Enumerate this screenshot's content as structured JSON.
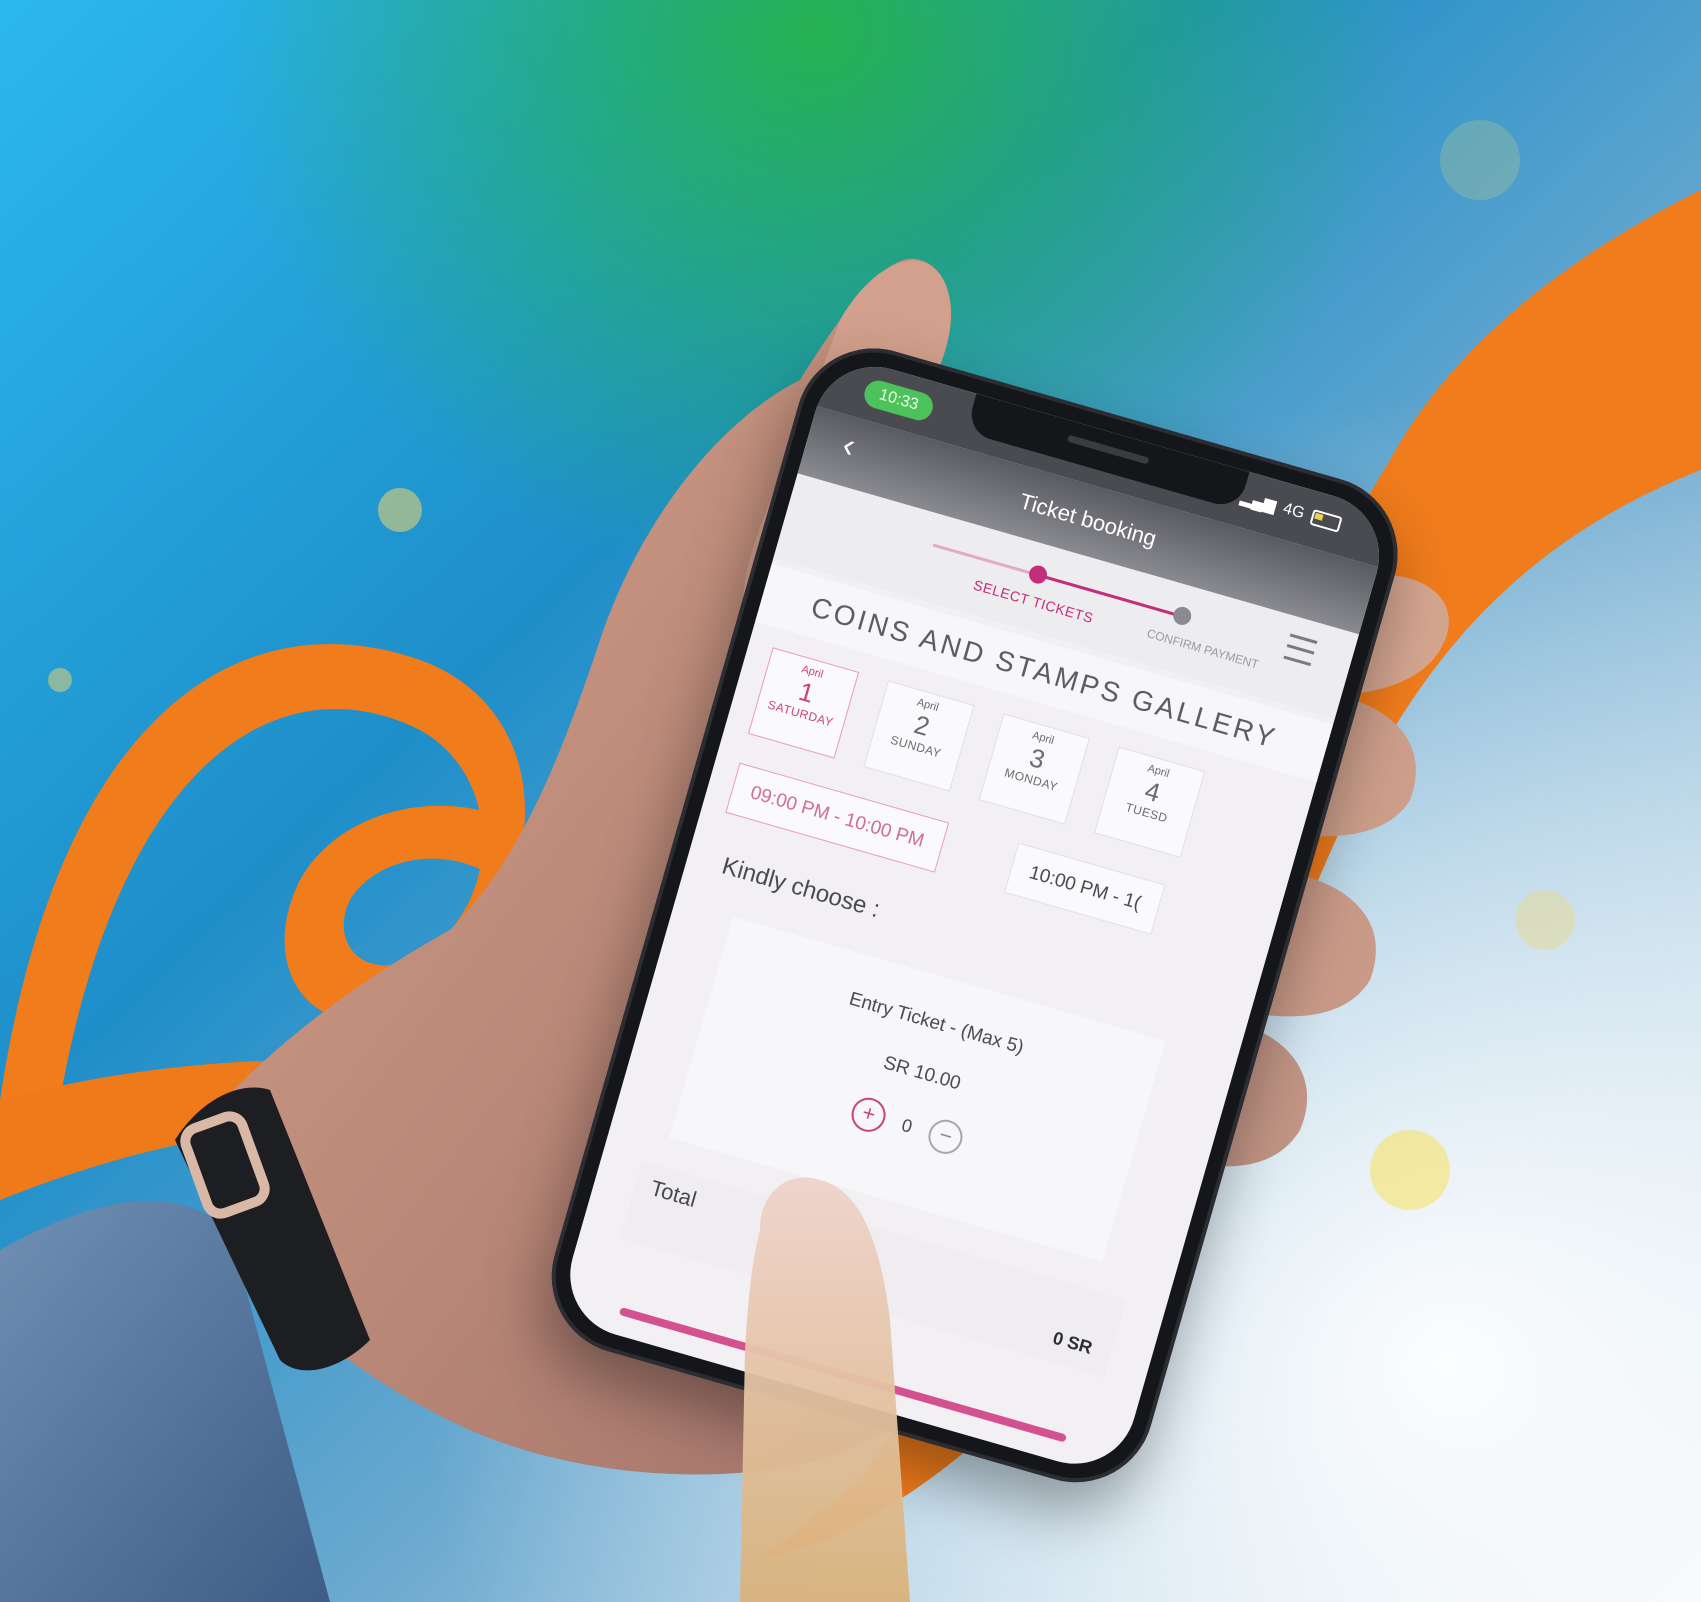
{
  "status_bar": {
    "time": "10:33",
    "network": "4G"
  },
  "header": {
    "title": "Ticket booking",
    "back_icon": "back-chevron-icon",
    "menu_icon": "hamburger-menu-icon"
  },
  "stepper": {
    "active_step": "SELECT TICKETS",
    "next_step": "CONFIRM PAYMENT"
  },
  "gallery_title": "COINS AND STAMPS GALLERY",
  "dates": [
    {
      "month": "April",
      "day": "1",
      "weekday": "SATURDAY",
      "selected": true
    },
    {
      "month": "April",
      "day": "2",
      "weekday": "SUNDAY",
      "selected": false
    },
    {
      "month": "April",
      "day": "3",
      "weekday": "MONDAY",
      "selected": false
    },
    {
      "month": "April",
      "day": "4",
      "weekday": "TUESD",
      "selected": false
    }
  ],
  "time_slots": [
    {
      "label": "09:00 PM - 10:00 PM",
      "selected": true
    },
    {
      "label": "10:00 PM - 1(",
      "selected": false
    }
  ],
  "kindly_choose": "Kindly choose :",
  "ticket": {
    "name": "Entry Ticket - (Max 5)",
    "price": "SR 10.00",
    "quantity": "0",
    "plus_label": "+",
    "minus_label": "−"
  },
  "total": {
    "label": "Total",
    "value": "0 SR"
  },
  "colors": {
    "accent": "#c9447f",
    "orange": "#f07c1c",
    "sky_blue": "#2fb2e6",
    "green": "#2ab34a"
  }
}
